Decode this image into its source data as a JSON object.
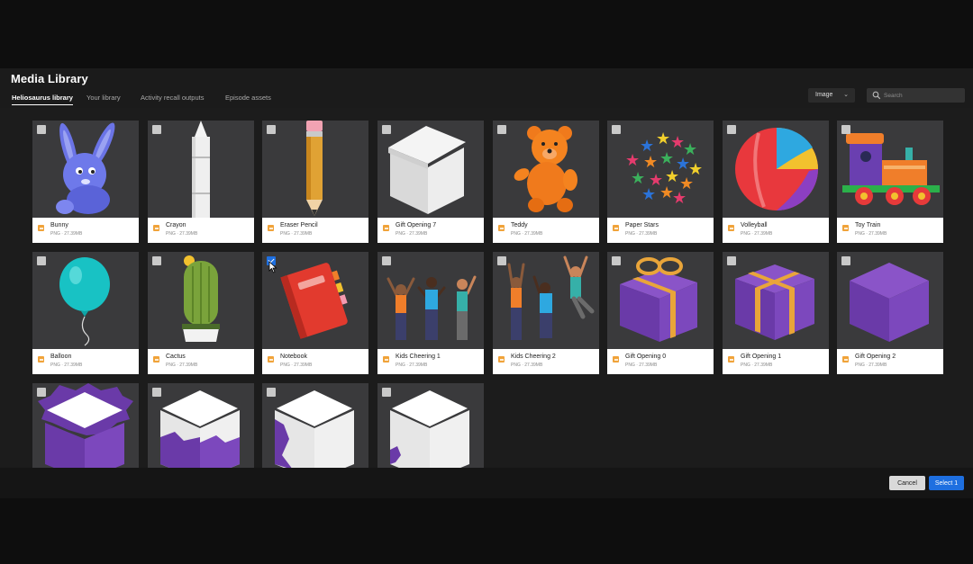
{
  "dialog": {
    "title": "Media Library",
    "tabs": [
      {
        "label": "Heliosaurus library",
        "active": true
      },
      {
        "label": "Your library",
        "active": false
      },
      {
        "label": "Activity recall outputs",
        "active": false
      },
      {
        "label": "Episode assets",
        "active": false
      }
    ],
    "type_filter": {
      "value": "Image",
      "icon": "chevron-down-icon"
    },
    "search": {
      "placeholder": "Search",
      "value": "",
      "icon": "search-icon"
    }
  },
  "items": [
    {
      "name": "Bunny",
      "meta": "PNG · 27.39MB",
      "checked": false,
      "icon": "bunny-icon"
    },
    {
      "name": "Crayon",
      "meta": "PNG · 27.39MB",
      "checked": false,
      "icon": "crayon-icon"
    },
    {
      "name": "Eraser Pencil",
      "meta": "PNG · 27.39MB",
      "checked": false,
      "icon": "pencil-icon"
    },
    {
      "name": "Gift Opening 7",
      "meta": "PNG · 27.39MB",
      "checked": false,
      "icon": "white-box-icon"
    },
    {
      "name": "Teddy",
      "meta": "PNG · 27.39MB",
      "checked": false,
      "icon": "teddy-bear-icon"
    },
    {
      "name": "Paper Stars",
      "meta": "PNG · 27.39MB",
      "checked": false,
      "icon": "stars-icon"
    },
    {
      "name": "Volleyball",
      "meta": "PNG · 27.39MB",
      "checked": false,
      "icon": "ball-icon"
    },
    {
      "name": "Toy Train",
      "meta": "PNG · 27.39MB",
      "checked": false,
      "icon": "train-icon"
    },
    {
      "name": "Balloon",
      "meta": "PNG · 27.39MB",
      "checked": false,
      "icon": "balloon-icon"
    },
    {
      "name": "Cactus",
      "meta": "PNG · 27.39MB",
      "checked": false,
      "icon": "cactus-icon"
    },
    {
      "name": "Notebook",
      "meta": "PNG · 27.39MB",
      "checked": true,
      "icon": "notebook-icon"
    },
    {
      "name": "Kids Cheering 1",
      "meta": "PNG · 27.39MB",
      "checked": false,
      "icon": "kids-cheering-icon"
    },
    {
      "name": "Kids Cheering 2",
      "meta": "PNG · 27.39MB",
      "checked": false,
      "icon": "kids-jumping-icon"
    },
    {
      "name": "Gift Opening 0",
      "meta": "PNG · 27.39MB",
      "checked": false,
      "icon": "gift-bow-icon"
    },
    {
      "name": "Gift Opening 1",
      "meta": "PNG · 27.39MB",
      "checked": false,
      "icon": "gift-ribbon-icon"
    },
    {
      "name": "Gift Opening 2",
      "meta": "PNG · 27.39MB",
      "checked": false,
      "icon": "purple-box-icon"
    },
    {
      "name": "",
      "meta": "",
      "checked": false,
      "icon": "box-torn-icon"
    },
    {
      "name": "",
      "meta": "",
      "checked": false,
      "icon": "box-torn-2-icon"
    },
    {
      "name": "",
      "meta": "",
      "checked": false,
      "icon": "box-torn-3-icon"
    },
    {
      "name": "",
      "meta": "",
      "checked": false,
      "icon": "box-torn-4-icon"
    }
  ],
  "footer": {
    "cancel_label": "Cancel",
    "select_label": "Select 1"
  },
  "colors": {
    "accent": "#1e6fe0",
    "file_icon": "#f0a33a",
    "card_bg": "#3a3a3c"
  }
}
